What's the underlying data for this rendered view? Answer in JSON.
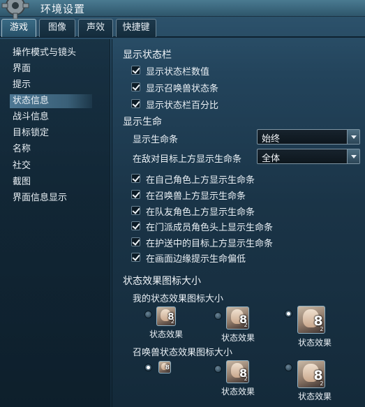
{
  "window": {
    "title": "环境设置"
  },
  "tabs": [
    {
      "label": "游戏",
      "active": true
    },
    {
      "label": "图像",
      "active": false
    },
    {
      "label": "声效",
      "active": false
    },
    {
      "label": "快捷键",
      "active": false
    }
  ],
  "sidebar": {
    "items": [
      {
        "label": "操作模式与镜头"
      },
      {
        "label": "界面"
      },
      {
        "label": "提示"
      },
      {
        "label": "状态信息",
        "selected": true
      },
      {
        "label": "战斗信息"
      },
      {
        "label": "目标锁定"
      },
      {
        "label": "名称"
      },
      {
        "label": "社交"
      },
      {
        "label": "截图"
      },
      {
        "label": "界面信息显示"
      }
    ]
  },
  "status_bar": {
    "header": "显示状态栏",
    "options": [
      {
        "label": "显示状态栏数值",
        "checked": true
      },
      {
        "label": "显示召唤兽状态条",
        "checked": true
      },
      {
        "label": "显示状态栏百分比",
        "checked": true
      }
    ]
  },
  "health": {
    "header": "显示生命",
    "show_bar": {
      "label": "显示生命条",
      "value": "始终"
    },
    "above_enemy": {
      "label": "在敌对目标上方显示生命条",
      "value": "全体"
    },
    "options": [
      {
        "label": "在自己角色上方显示生命条",
        "checked": true
      },
      {
        "label": "在召唤兽上方显示生命条",
        "checked": true
      },
      {
        "label": "在队友角色上方显示生命条",
        "checked": true
      },
      {
        "label": "在门派成员角色头上显示生命条",
        "checked": true
      },
      {
        "label": "在护送中的目标上方显示生命条",
        "checked": true
      },
      {
        "label": "在画面边缘提示生命偏低",
        "checked": true
      }
    ]
  },
  "icon_size": {
    "header": "状态效果图标大小",
    "mine": {
      "label": "我的状态效果图标大小",
      "selected_index": 2,
      "options": [
        {
          "label": "状态效果",
          "icon_number": "8",
          "icon_sub": "2"
        },
        {
          "label": "状态效果",
          "icon_number": "8",
          "icon_sub": "2"
        },
        {
          "label": "状态效果",
          "icon_number": "8",
          "icon_sub": "2"
        }
      ]
    },
    "summon": {
      "label": "召唤兽状态效果图标大小",
      "selected_index": 0,
      "options": [
        {
          "label": "",
          "icon_number": "8",
          "icon_sub": "2"
        },
        {
          "label": "状态效果",
          "icon_number": "8",
          "icon_sub": "2"
        },
        {
          "label": "状态效果",
          "icon_number": "8",
          "icon_sub": "2"
        }
      ]
    }
  },
  "icons": {
    "title": "gear-icon",
    "checkbox": "checkmark-icon",
    "dropdown": "chevron-down-icon",
    "status_effect": "status-effect-portrait-icon"
  },
  "colors": {
    "accent": "#3a6b85",
    "background": "#1a3447",
    "text": "#eaf0f5"
  }
}
